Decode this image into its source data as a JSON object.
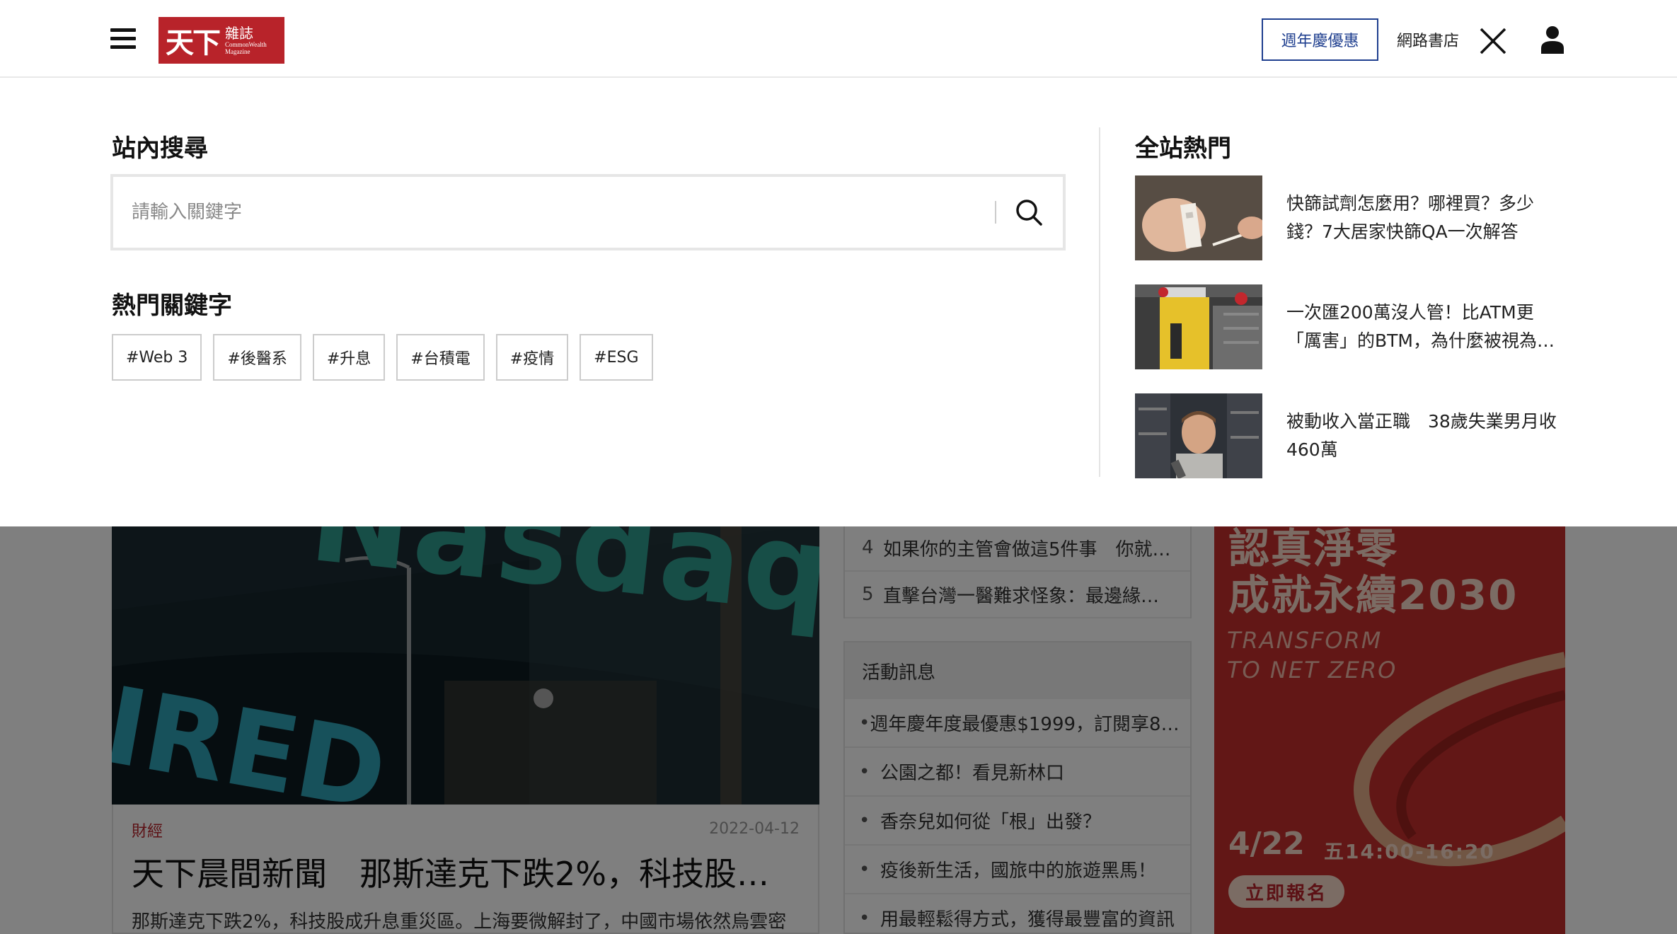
{
  "header": {
    "logo_main": "天下",
    "logo_zh": "雜誌",
    "logo_en_line1": "CommonWealth",
    "logo_en_line2": "Magazine",
    "promo_label": "週年慶優惠",
    "bookstore_label": "網路書店"
  },
  "search": {
    "title": "站內搜尋",
    "placeholder": "請輸入關鍵字",
    "value": ""
  },
  "keywords": {
    "title": "熱門關鍵字",
    "items": [
      "#Web 3",
      "#後醫系",
      "#升息",
      "#台積電",
      "#疫情",
      "#ESG"
    ]
  },
  "hot": {
    "title": "全站熱門",
    "items": [
      {
        "text": "快篩試劑怎麼用？哪裡買？多少錢？7大居家快篩QA一次解答",
        "thumb_icon": "rapid-test-photo"
      },
      {
        "text": "一次匯200萬沒人管！比ATM更「厲害」的BTM，為什麼被視為…",
        "thumb_icon": "btm-machine-photo"
      },
      {
        "text": "被動收入當正職　38歲失業男月收460萬",
        "thumb_icon": "youtuber-photo"
      }
    ]
  },
  "background": {
    "article": {
      "category": "財經",
      "date": "2022-04-12",
      "title": "天下晨間新聞　那斯達克下跌2%，科技股為…",
      "summary": "那斯達克下跌2%，科技股成升息重災區。上海要微解封了，中國市場依然烏雲密",
      "hero_sign": "Nasdaq",
      "hero_sign2": "IRED"
    },
    "ranking": [
      {
        "num": "4",
        "text": "如果你的主管會做這5件事　你就…"
      },
      {
        "num": "5",
        "text": "直擊台灣一醫難求怪象：最邊緣…"
      }
    ],
    "events": {
      "title": "活動訊息",
      "items": [
        "週年慶年度最優惠$1999，訂閱享8…",
        "公園之都！看見新林口",
        "香奈兒如何從「根」出發？",
        "疫後新生活，國旅中的旅遊黑馬！",
        "用最輕鬆得方式，獲得最豐富的資訊"
      ]
    },
    "ad": {
      "title_line1": "認真淨零",
      "title_line2": "成就永續2030",
      "sub_line1": "TRANSFORM",
      "sub_line2": "TO NET ZERO",
      "date": "4/22",
      "time": "五14:00-16:20",
      "cta": "立即報名"
    }
  },
  "colors": {
    "brand_red": "#b8232a",
    "promo_blue": "#1f3f8f",
    "overlay": "rgba(0,0,0,0.5)"
  }
}
